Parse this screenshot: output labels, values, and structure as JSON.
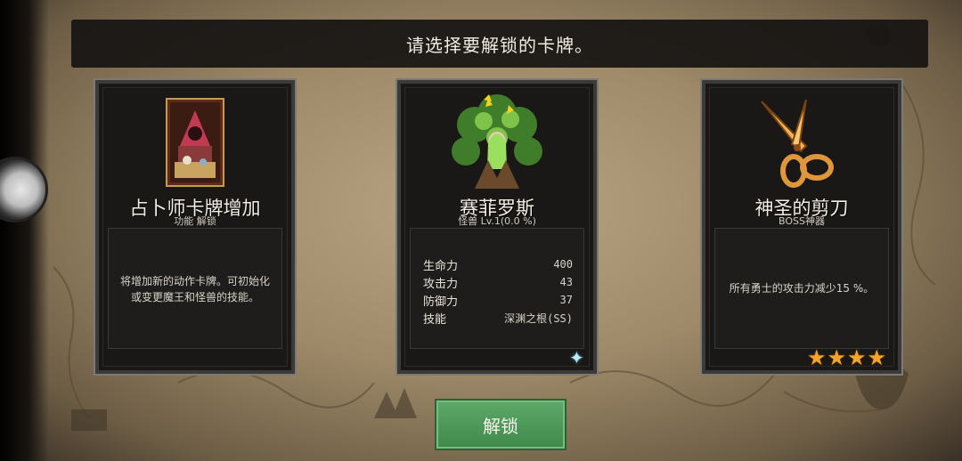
{
  "title": "请选择要解锁的卡牌。",
  "cards": [
    {
      "name": "占卜师卡牌增加",
      "subtitle": "功能 解锁",
      "description_line1": "将增加新的动作卡牌。可初始化",
      "description_line2": "或变更魔王和怪兽的技能。",
      "icon": "fortune-teller-card-icon"
    },
    {
      "name": "赛菲罗斯",
      "subtitle": "怪兽 Lv.1(0.0 %)",
      "icon": "tree-monster-icon",
      "stats": [
        {
          "label": "生命力",
          "value": "400"
        },
        {
          "label": "攻击力",
          "value": "43"
        },
        {
          "label": "防御力",
          "value": "37"
        },
        {
          "label": "技能",
          "value": "深渊之根(SS)"
        }
      ],
      "badge": "✦"
    },
    {
      "name": "神圣的剪刀",
      "subtitle": "BOSS神器",
      "description": "所有勇士的攻击力减少15 %。",
      "icon": "golden-scissors-icon",
      "rating": 4
    }
  ],
  "unlock_button": "解锁",
  "colors": {
    "button": "#4f9a5a",
    "star": "#f3a52b",
    "title_bar": "#161412"
  }
}
